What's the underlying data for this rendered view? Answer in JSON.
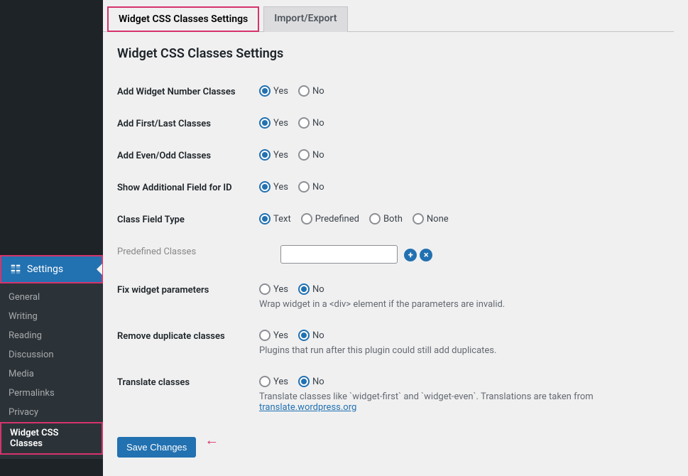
{
  "sidebar": {
    "settings_label": "Settings",
    "items": [
      {
        "label": "General"
      },
      {
        "label": "Writing"
      },
      {
        "label": "Reading"
      },
      {
        "label": "Discussion"
      },
      {
        "label": "Media"
      },
      {
        "label": "Permalinks"
      },
      {
        "label": "Privacy"
      },
      {
        "label": "Widget CSS Classes"
      }
    ]
  },
  "tabs": {
    "widget_settings": "Widget CSS Classes Settings",
    "import_export": "Import/Export"
  },
  "page": {
    "heading": "Widget CSS Classes Settings"
  },
  "fields": {
    "add_number": {
      "label": "Add Widget Number Classes",
      "yes": "Yes",
      "no": "No",
      "value": "yes"
    },
    "add_first_last": {
      "label": "Add First/Last Classes",
      "yes": "Yes",
      "no": "No",
      "value": "yes"
    },
    "add_even_odd": {
      "label": "Add Even/Odd Classes",
      "yes": "Yes",
      "no": "No",
      "value": "yes"
    },
    "show_id": {
      "label": "Show Additional Field for ID",
      "yes": "Yes",
      "no": "No",
      "value": "yes"
    },
    "class_type": {
      "label": "Class Field Type",
      "options": {
        "text": "Text",
        "predefined": "Predefined",
        "both": "Both",
        "none": "None"
      },
      "value": "text"
    },
    "predefined": {
      "label": "Predefined Classes",
      "value": ""
    },
    "fix_params": {
      "label": "Fix widget parameters",
      "yes": "Yes",
      "no": "No",
      "value": "no",
      "desc": "Wrap widget in a <div> element if the parameters are invalid."
    },
    "remove_dup": {
      "label": "Remove duplicate classes",
      "yes": "Yes",
      "no": "No",
      "value": "no",
      "desc": "Plugins that run after this plugin could still add duplicates."
    },
    "translate": {
      "label": "Translate classes",
      "yes": "Yes",
      "no": "No",
      "value": "no",
      "desc_prefix": "Translate classes like `widget-first` and `widget-even`. Translations are taken from ",
      "desc_link": "translate.wordpress.org"
    }
  },
  "buttons": {
    "save": "Save Changes"
  }
}
